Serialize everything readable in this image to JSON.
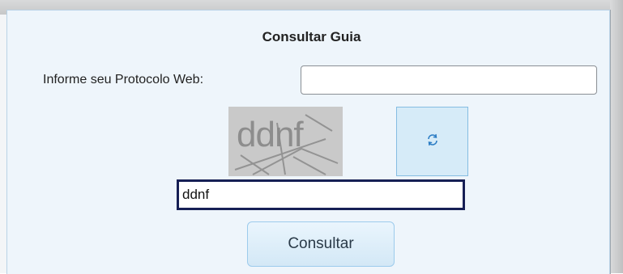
{
  "form": {
    "title": "Consultar Guia",
    "protocol_label": "Informe seu Protocolo Web:",
    "protocol_value": "",
    "captcha_text": "ddnf",
    "captcha_input_value": "ddnf",
    "submit_label": "Consultar"
  },
  "icons": {
    "refresh": "refresh-icon"
  },
  "colors": {
    "panel_background": "#eef5fb",
    "panel_border": "#b9d2e6",
    "refresh_button": "#d6ebf8",
    "focused_input_border": "#161f55",
    "submit_button": "#d3e8f6"
  }
}
